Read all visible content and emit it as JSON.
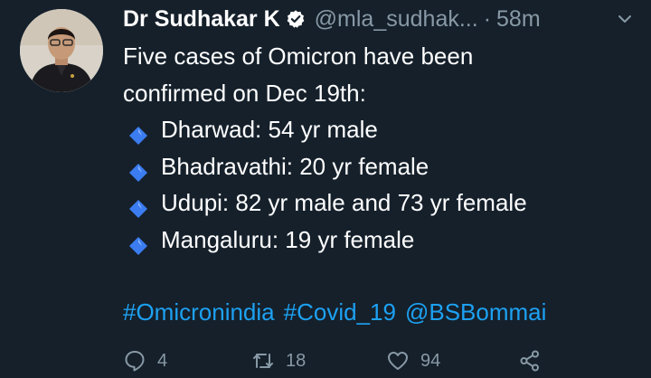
{
  "tweet": {
    "author_name": "Dr Sudhakar K",
    "handle": "@mla_sudhak...",
    "separator": "·",
    "time": "58m",
    "intro": "Five cases of Omicron have been confirmed on Dec 19th:",
    "intro_line1": "Five cases of Omicron have been",
    "intro_line2": "confirmed on Dec 19th:",
    "bullets": [
      "Dharwad: 54 yr male",
      "Bhadravathi: 20 yr female",
      "Udupi: 82 yr male and 73 yr female",
      "Mangaluru: 19 yr female"
    ],
    "tags": [
      "#Omicronindia",
      "#Covid_19",
      "@BSBommai"
    ]
  },
  "actions": {
    "reply_count": "4",
    "retweet_count": "18",
    "like_count": "94"
  },
  "icons": {
    "verified": "verified-badge-icon",
    "caret": "chevron-down-icon",
    "bullet": "small-blue-diamond-icon",
    "reply": "reply-icon",
    "retweet": "retweet-icon",
    "like": "heart-icon",
    "share": "share-icon"
  },
  "colors": {
    "background": "#15202b",
    "text": "#ffffff",
    "muted": "#8899a6",
    "link": "#1da1f2",
    "diamond": "#3b7df0"
  }
}
